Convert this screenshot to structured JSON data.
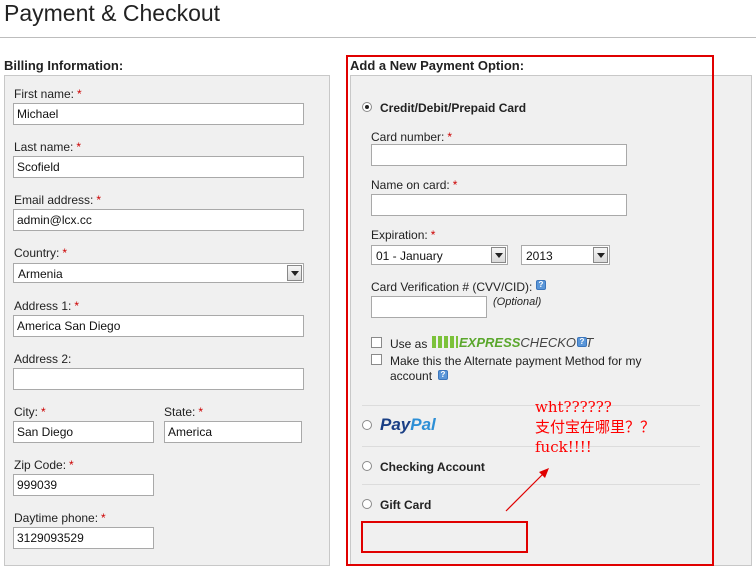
{
  "page": {
    "title": "Payment & Checkout"
  },
  "billing": {
    "heading": "Billing Information:",
    "required_marker": "*",
    "first_name": {
      "label": "First name:",
      "value": "Michael"
    },
    "last_name": {
      "label": "Last name:",
      "value": "Scofield"
    },
    "email": {
      "label": "Email address:",
      "value": "admin@lcx.cc"
    },
    "country": {
      "label": "Country:",
      "value": "Armenia"
    },
    "address1": {
      "label": "Address 1:",
      "value": "America San Diego"
    },
    "address2": {
      "label": "Address 2:",
      "value": ""
    },
    "city": {
      "label": "City:",
      "value": "San Diego"
    },
    "state": {
      "label": "State:",
      "value": "America"
    },
    "zip": {
      "label": "Zip Code:",
      "value": "999039"
    },
    "phone": {
      "label": "Daytime phone:",
      "value": "3129093529"
    }
  },
  "payment": {
    "heading": "Add a New Payment Option:",
    "credit": {
      "label": "Credit/Debit/Prepaid Card",
      "card_number": {
        "label": "Card number:",
        "value": ""
      },
      "name_on_card": {
        "label": "Name on card:",
        "value": ""
      },
      "expiration": {
        "label": "Expiration:",
        "month": "01 - January",
        "year": "2013"
      },
      "cvv": {
        "label": "Card Verification # (CVV/CID):",
        "optional": "(Optional)",
        "value": ""
      },
      "use_as": "Use as",
      "express_checkout": {
        "express": "EXPRESS",
        "checkout": "CHECKOUT"
      },
      "alternate": {
        "line1": "Make this the Alternate payment Method for my",
        "line2": "account"
      },
      "help_glyph": "?"
    },
    "paypal": {
      "pay": "Pay",
      "pal": "Pal"
    },
    "checking": {
      "label": "Checking Account"
    },
    "gift": {
      "label": "Gift Card"
    }
  },
  "annotation": {
    "line1": "wht??????",
    "line2": "支付宝在哪里？？",
    "line3": "fuck!!!!",
    "color": "#ff0000"
  }
}
